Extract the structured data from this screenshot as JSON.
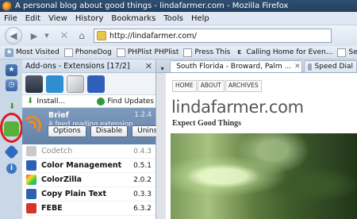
{
  "window": {
    "title": "A personal blog about good things - lindafarmer.com - Mozilla Firefox"
  },
  "menu": [
    "File",
    "Edit",
    "View",
    "History",
    "Bookmarks",
    "Tools",
    "Help"
  ],
  "nav": {
    "url": "http://lindafarmer.com/"
  },
  "bookmarks": [
    "Most Visited",
    "PhoneDog",
    "PHPlist PHPlist",
    "Press This",
    "Calling Home for Even...",
    "Send Feedback"
  ],
  "addons": {
    "header": "Add-ons - Extensions [17/2]",
    "close": "✕",
    "install": "Install...",
    "find_updates": "Find Updates",
    "selected": {
      "name": "Brief",
      "version": "1.2.4",
      "description": "A feed reading extension.",
      "options": "Options",
      "disable": "Disable",
      "uninstall": "Uninstall"
    },
    "items": [
      {
        "name": "Codetch",
        "version": "0.4.3",
        "disabled": true
      },
      {
        "name": "Color Management",
        "version": "0.5.1"
      },
      {
        "name": "ColorZilla",
        "version": "2.0.2"
      },
      {
        "name": "Copy Plain Text",
        "version": "0.3.3"
      },
      {
        "name": "FEBE",
        "version": "6.3.2"
      }
    ]
  },
  "tabs": [
    {
      "title": "South Florida - Broward, Palm ...",
      "close": "✕"
    },
    {
      "title": "Speed Dial"
    }
  ],
  "webpage": {
    "nav": [
      "HOME",
      "ABOUT",
      "ARCHIVES"
    ],
    "title": "lindafarmer.com",
    "tagline": "Expect Good Things"
  },
  "colors": {
    "titlebar": "#2f4f72",
    "selected_row": "#6f8db1",
    "highlight_circle": "#e01a1a"
  }
}
